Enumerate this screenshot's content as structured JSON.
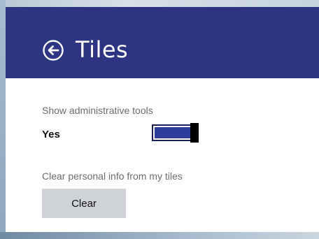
{
  "header": {
    "back_icon": "back-arrow-circle-icon",
    "title": "Tiles"
  },
  "settings": {
    "admin_tools": {
      "label": "Show administrative tools",
      "value_label": "Yes",
      "enabled": true
    },
    "clear_info": {
      "label": "Clear personal info from my tiles",
      "button_label": "Clear"
    }
  },
  "colors": {
    "header_bg": "#2d3481",
    "toggle_fill": "#2d3c9a",
    "button_bg": "#cfd2d6"
  }
}
